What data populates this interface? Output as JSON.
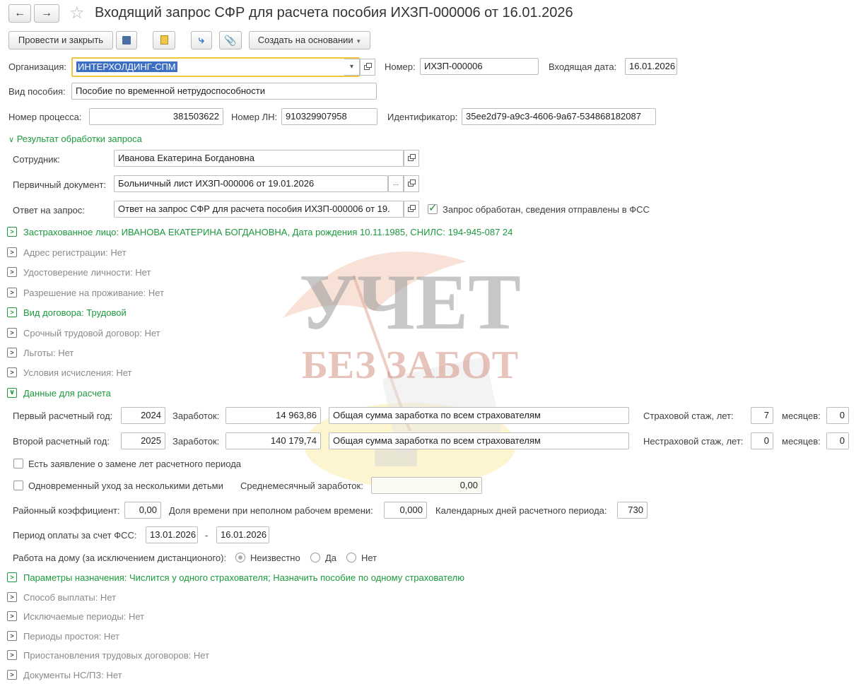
{
  "header": {
    "title": "Входящий запрос СФР для расчета пособия ИХЗП-000006 от 16.01.2026"
  },
  "toolbar": {
    "post_close": "Провести и закрыть",
    "create_based": "Создать на основании"
  },
  "form": {
    "org_label": "Организация:",
    "org_value": "ИНТЕРХОЛДИНГ-СПМ",
    "number_label": "Номер:",
    "number_value": "ИХЗП-000006",
    "date_label": "Входящая дата:",
    "date_value": "16.01.2026",
    "benefit_label": "Вид пособия:",
    "benefit_value": "Пособие по временной нетрудоспособности",
    "process_label": "Номер процесса:",
    "process_value": "381503622",
    "ln_label": "Номер ЛН:",
    "ln_value": "910329907958",
    "id_label": "Идентификатор:",
    "id_value": "35ee2d79-a9c3-4606-9a67-534868182087"
  },
  "result": {
    "title": "Результат обработки запроса",
    "employee_label": "Сотрудник:",
    "employee_value": "Иванова Екатерина Богдановна",
    "primary_label": "Первичный документ:",
    "primary_value": "Больничный лист ИХЗП-000006 от 19.01.2026",
    "answer_label": "Ответ на запрос:",
    "answer_value": "Ответ на запрос СФР для расчета пособия ИХЗП-000006 от 19.",
    "processed_label": "Запрос обработан, сведения отправлены в ФСС"
  },
  "sections": {
    "insured": "Застрахованное лицо: ИВАНОВА ЕКАТЕРИНА БОГДАНОВНА, Дата рождения 10.11.1985, СНИЛС: 194-945-087 24",
    "address": "Адрес регистрации: Нет",
    "identity": "Удостоверение личности: Нет",
    "residence": "Разрешение на проживание: Нет",
    "contract": "Вид договора: Трудовой",
    "fixed_term": "Срочный трудовой договор: Нет",
    "benefits": "Льготы: Нет",
    "conditions": "Условия исчисления: Нет",
    "calc_data": "Данные для расчета",
    "params": "Параметры назначения: Числится у одного страхователя; Назначить пособие по одному страхователю",
    "payment": "Способ выплаты: Нет",
    "excluded": "Исключаемые периоды: Нет",
    "downtime": "Периоды простоя: Нет",
    "suspension": "Приостановления трудовых договоров: Нет",
    "docs": "Документы НС/ПЗ: Нет"
  },
  "calc": {
    "year1_label": "Первый расчетный год:",
    "year1": "2024",
    "earn_label": "Заработок:",
    "earn1": "14 963,86",
    "earn_desc": "Общая сумма заработка по всем страхователям",
    "ins_label": "Страховой стаж, лет:",
    "ins_years": "7",
    "months_label": "месяцев:",
    "ins_months": "0",
    "year2_label": "Второй расчетный год:",
    "year2": "2025",
    "earn2": "140 179,74",
    "noins_label": "Нестраховой стаж, лет:",
    "noins_years": "0",
    "noins_months": "0",
    "replace_label": "Есть заявление о замене лет расчетного периода",
    "multi_label": "Одновременный уход за несколькими детьми",
    "avg_label": "Среднемесячный заработок:",
    "avg_value": "0,00",
    "district_label": "Районный коэффициент:",
    "district_value": "0,00",
    "parttime_label": "Доля времени при неполном рабочем времени:",
    "parttime_value": "0,000",
    "days_label": "Календарных дней расчетного периода:",
    "days_value": "730",
    "period_label": "Период оплаты за счет ФСС:",
    "period_from": "13.01.2026",
    "period_dash": "-",
    "period_to": "16.01.2026",
    "home_label": "Работа на дому (за исключением дистанционого):",
    "home_opt1": "Неизвестно",
    "home_opt2": "Да",
    "home_opt3": "Нет"
  },
  "watermark": {
    "line1": "УЧЕТ",
    "line2": "БЕЗ ЗАБОТ"
  }
}
